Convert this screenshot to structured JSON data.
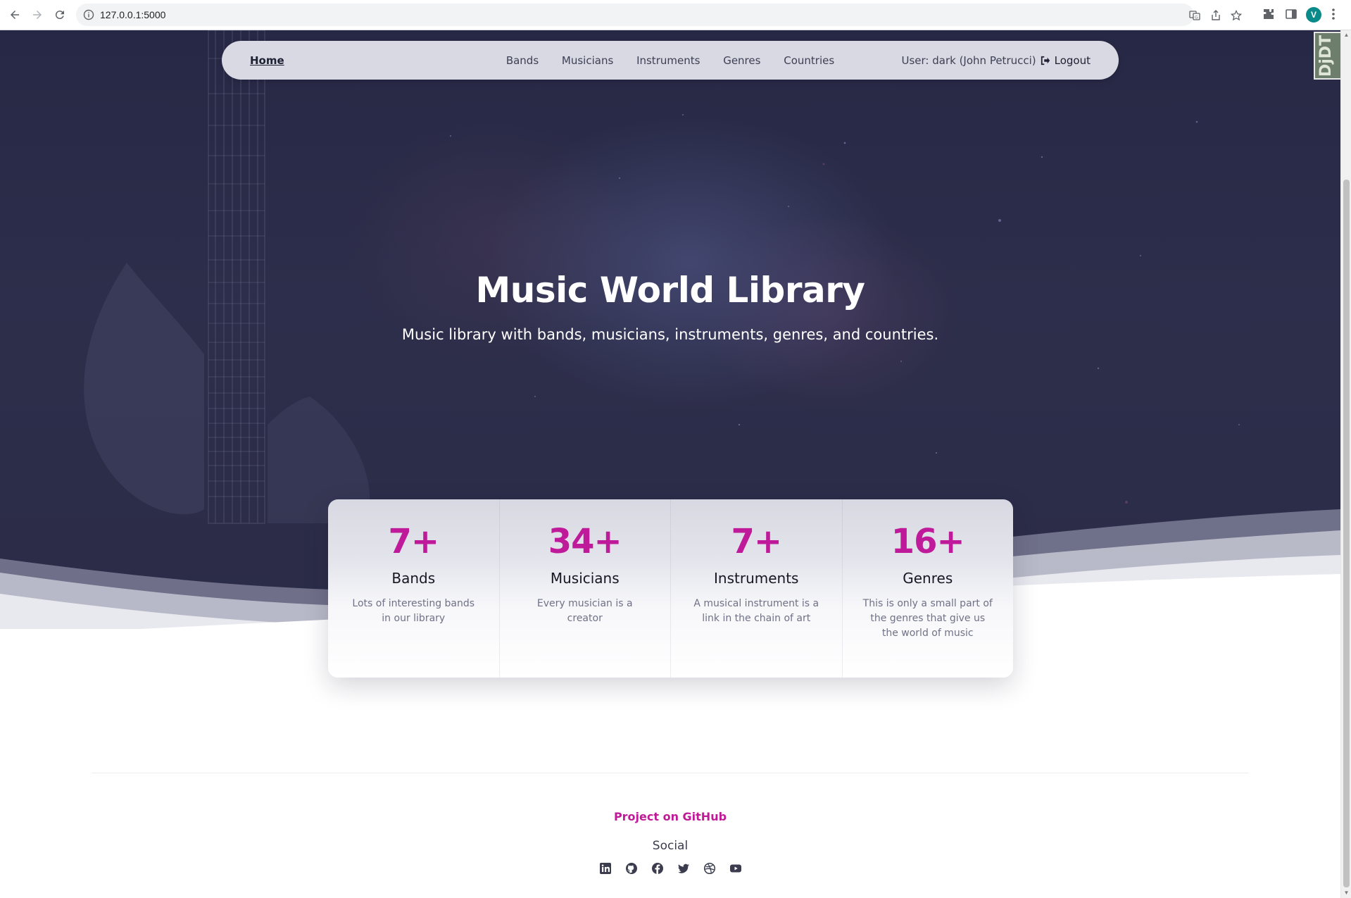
{
  "browser": {
    "url": "127.0.0.1:5000",
    "profile_initial": "V",
    "icons": [
      "back-icon",
      "forward-icon",
      "reload-icon",
      "info-icon",
      "translate-icon",
      "share-icon",
      "star-icon",
      "extensions-icon",
      "side-panel-icon",
      "menu-icon"
    ]
  },
  "navbar": {
    "home": "Home",
    "links": [
      "Bands",
      "Musicians",
      "Instruments",
      "Genres",
      "Countries"
    ],
    "user": "User: dark (John Petrucci)",
    "logout": "Logout"
  },
  "hero": {
    "title": "Music World Library",
    "subtitle": "Music library with bands, musicians, instruments, genres, and countries."
  },
  "stats": [
    {
      "value": "7+",
      "label": "Bands",
      "desc": "Lots of interesting bands in our library"
    },
    {
      "value": "34+",
      "label": "Musicians",
      "desc": "Every musician is a creator"
    },
    {
      "value": "7+",
      "label": "Instruments",
      "desc": "A musical instrument is a link in the chain of art"
    },
    {
      "value": "16+",
      "label": "Genres",
      "desc": "This is only a small part of the genres that give us the world of music"
    }
  ],
  "footer": {
    "github": "Project on GitHub",
    "social_title": "Social",
    "social_icons": [
      "linkedin-icon",
      "github-icon",
      "facebook-icon",
      "twitter-icon",
      "dribbble-icon",
      "youtube-icon"
    ]
  },
  "extension_badge": "DjDT",
  "colors": {
    "accent": "#c01a97",
    "hero_bg": "#2b2c47",
    "navbar_bg": "#d8d9e2"
  }
}
